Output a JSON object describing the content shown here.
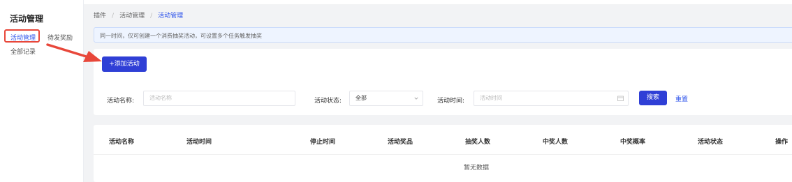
{
  "sidebar": {
    "title": "活动管理",
    "items": [
      {
        "label": "活动管理",
        "active": true
      },
      {
        "label": "待发奖励",
        "active": false
      },
      {
        "label": "全部记录",
        "active": false
      }
    ]
  },
  "breadcrumb": [
    "插件",
    "活动管理",
    "活动管理"
  ],
  "notice": "同一时间，仅可创建一个消费抽奖活动，可设置多个任务触发抽奖",
  "toolbar": {
    "add_label": "+添加活动"
  },
  "filters": {
    "name_label": "活动名称:",
    "name_placeholder": "活动名称",
    "status_label": "活动状态:",
    "status_value": "全部",
    "time_label": "活动时间:",
    "time_placeholder": "活动时间",
    "search_label": "搜索",
    "reset_label": "重置"
  },
  "table": {
    "columns": [
      "活动名称",
      "活动时间",
      "停止时间",
      "活动奖品",
      "抽奖人数",
      "中奖人数",
      "中奖概率",
      "活动状态",
      "操作"
    ],
    "rows": [],
    "empty_text": "暂无数据"
  },
  "colors": {
    "accent": "#2f3fd6",
    "link": "#2f54eb",
    "annotation": "#e8473a"
  }
}
